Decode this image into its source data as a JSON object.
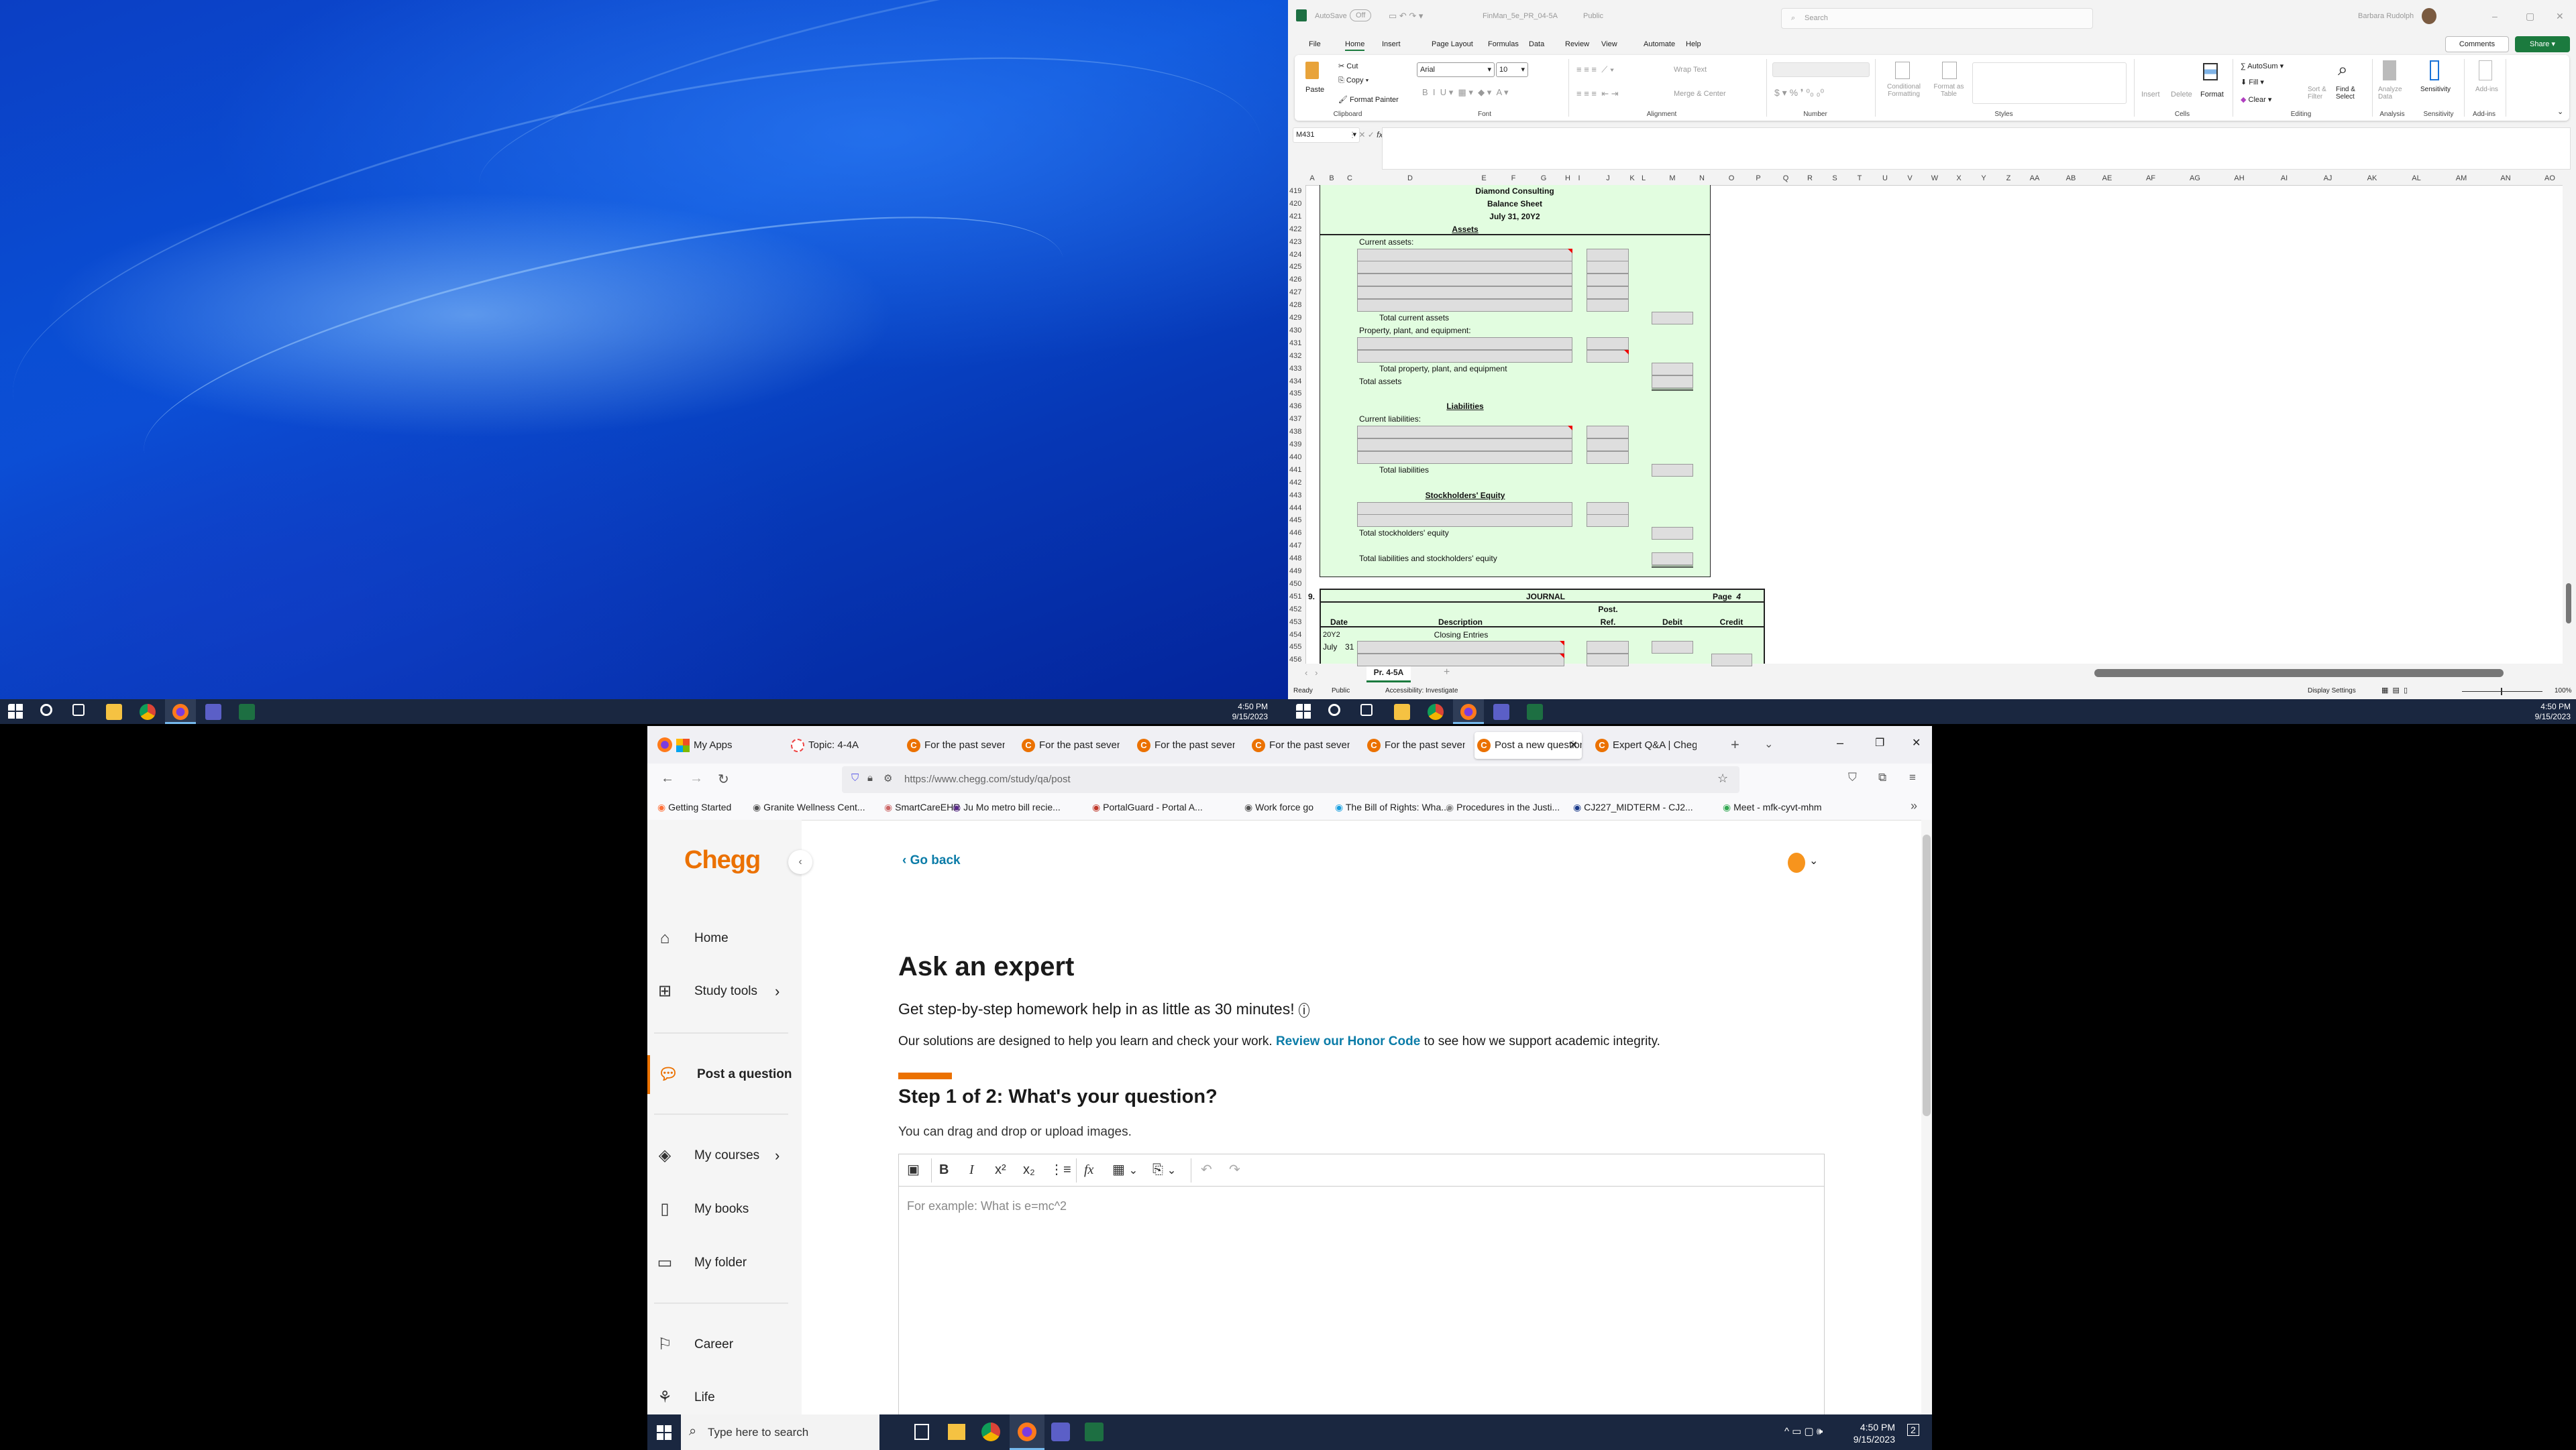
{
  "desktop_left": {
    "taskbar": {
      "time": "4:50 PM",
      "date": "9/15/2023",
      "icons": [
        "windows-start-icon",
        "search-icon",
        "task-view-icon",
        "file-explorer-icon",
        "chrome-icon",
        "firefox-icon",
        "teams-icon",
        "excel-icon"
      ]
    }
  },
  "excel": {
    "titlebar": {
      "autosave": "AutoSave",
      "autosave_state": "Off",
      "filename": "FinMan_5e_PR_04-5A",
      "sensitivity": "Public",
      "search_placeholder": "Search",
      "user": "Barbara Rudolph"
    },
    "menu": [
      "File",
      "Home",
      "Insert",
      "Page Layout",
      "Formulas",
      "Data",
      "Review",
      "View",
      "Automate",
      "Help"
    ],
    "active_menu": "Home",
    "comments": "Comments",
    "share": "Share",
    "ribbon": {
      "paste": "Paste",
      "cut": "Cut",
      "copy": "Copy",
      "format_painter": "Format Painter",
      "font": "Arial",
      "font_size": "10",
      "wrap_text": "Wrap Text",
      "merge_center": "Merge & Center",
      "conditional_formatting": "Conditional Formatting",
      "format_as_table": "Format as Table",
      "insert": "Insert",
      "delete": "Delete",
      "format": "Format",
      "autosum": "AutoSum",
      "fill": "Fill",
      "clear": "Clear",
      "sort_filter": "Sort & Filter",
      "find_select": "Find & Select",
      "analyze_data": "Analyze Data",
      "sensitivity": "Sensitivity",
      "addins": "Add-ins",
      "groups": [
        "Clipboard",
        "Font",
        "Alignment",
        "Number",
        "Styles",
        "Cells",
        "Editing",
        "Analysis",
        "Sensitivity",
        "Add-ins"
      ]
    },
    "name_box": "M431",
    "formula": "",
    "columns": [
      "A",
      "B",
      "C",
      "D",
      "E",
      "F",
      "G",
      "H",
      "I",
      "J",
      "K",
      "L",
      "M",
      "N",
      "O",
      "P",
      "Q",
      "R",
      "S",
      "T",
      "U",
      "V",
      "W",
      "X",
      "Y",
      "Z",
      "AA",
      "AB",
      "AE",
      "AF",
      "AG",
      "AH",
      "AI",
      "AJ",
      "AK",
      "AL",
      "AM",
      "AN",
      "AO"
    ],
    "rows": [
      "419",
      "420",
      "421",
      "422",
      "423",
      "424",
      "425",
      "426",
      "427",
      "428",
      "429",
      "430",
      "431",
      "432",
      "433",
      "434",
      "435",
      "436",
      "437",
      "438",
      "439",
      "440",
      "441",
      "442",
      "443",
      "444",
      "445",
      "446",
      "447",
      "448",
      "449",
      "450",
      "451",
      "452",
      "453",
      "454",
      "455",
      "456"
    ],
    "balance_sheet": {
      "company": "Diamond Consulting",
      "title": "Balance Sheet",
      "date": "July 31, 20Y2",
      "assets": "Assets",
      "current_assets": "Current assets:",
      "total_current_assets": "Total current assets",
      "ppe": "Property, plant, and equipment:",
      "total_ppe": "Total property, plant, and equipment",
      "total_assets": "Total assets",
      "liabilities": "Liabilities",
      "current_liabilities": "Current liabilities:",
      "total_liabilities": "Total liabilities",
      "equity": "Stockholders' Equity",
      "total_equity": "Total stockholders' equity",
      "total_liab_equity": "Total liabilities and stockholders' equity"
    },
    "journal": {
      "number": "9.",
      "title": "JOURNAL",
      "page_label": "Page",
      "page": "4",
      "post": "Post.",
      "ref": "Ref.",
      "date": "Date",
      "description": "Description",
      "debit": "Debit",
      "credit": "Credit",
      "year": "20Y2",
      "closing": "Closing Entries",
      "month": "July",
      "day": "31"
    },
    "sheet_tab": "Pr. 4-5A",
    "status": {
      "ready": "Ready",
      "public": "Public",
      "accessibility": "Accessibility: Investigate",
      "display_settings": "Display Settings",
      "zoom": "100%"
    },
    "taskbar": {
      "time": "4:50 PM",
      "date": "9/15/2023"
    }
  },
  "browser": {
    "tabs": [
      {
        "label": "My Apps"
      },
      {
        "label": "Topic: 4-4A"
      },
      {
        "label": "For the past seven"
      },
      {
        "label": "For the past seven"
      },
      {
        "label": "For the past seven"
      },
      {
        "label": "For the past seven"
      },
      {
        "label": "For the past seven"
      },
      {
        "label": "Post a new question",
        "active": true
      },
      {
        "label": "Expert Q&A | Chegg"
      }
    ],
    "url": "https://www.chegg.com/study/qa/post",
    "bookmarks": [
      "Getting Started",
      "Granite Wellness Cent...",
      "SmartCareEHR",
      "Ju Mo metro bill recie...",
      "PortalGuard - Portal A...",
      "Work force go",
      "The Bill of Rights: Wha...",
      "Procedures in the Justi...",
      "CJ227_MIDTERM - CJ2...",
      "Meet - mfk-cyvt-mhm"
    ]
  },
  "chegg": {
    "logo": "Chegg",
    "go_back": "Go back",
    "brand_color": "#eb7100",
    "link_color": "#0b7ca8",
    "nav": [
      {
        "label": "Home",
        "icon": "home-icon"
      },
      {
        "label": "Study tools",
        "icon": "grid-icon"
      },
      {
        "label": "Post a question",
        "icon": "qa-icon",
        "active": true
      },
      {
        "label": "My courses",
        "icon": "layers-icon"
      },
      {
        "label": "My books",
        "icon": "book-icon"
      },
      {
        "label": "My folder",
        "icon": "folder-icon"
      },
      {
        "label": "Career",
        "icon": "career-icon"
      },
      {
        "label": "Life",
        "icon": "plant-icon"
      }
    ],
    "title": "Ask an expert",
    "subtitle": "Get step-by-step homework help in as little as 30 minutes!",
    "info_pre": "Our solutions are designed to help you learn and check your work. ",
    "info_link": "Review our Honor Code",
    "info_post": " to see how we support academic integrity.",
    "step_progress": 0.5,
    "step_title": "Step 1 of 2: What's your question?",
    "upload_hint": "You can drag and drop or upload images.",
    "editor_placeholder": "For example: What is e=mc^2"
  },
  "taskbar_bottom": {
    "search_placeholder": "Type here to search",
    "time": "4:50 PM",
    "date": "9/15/2023",
    "notifications": "2"
  }
}
